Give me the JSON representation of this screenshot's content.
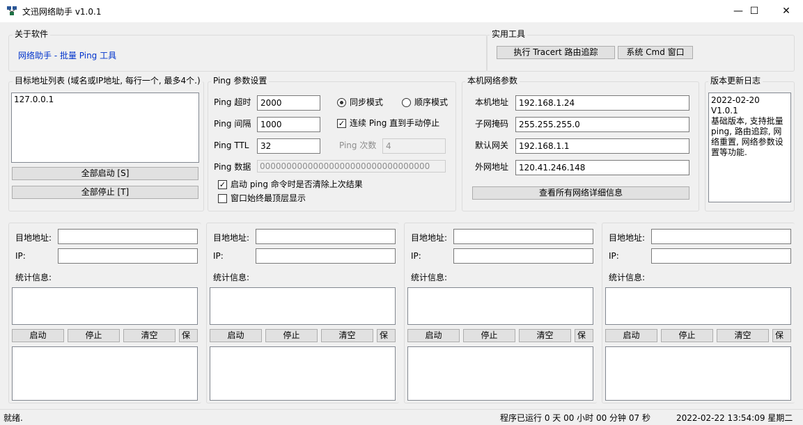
{
  "window": {
    "title": "文迅网络助手  v1.0.1",
    "minimize": "—",
    "maximize": "☐",
    "close": "✕"
  },
  "about": {
    "legend": "关于软件",
    "link": "网络助手 - 批量 Ping 工具"
  },
  "tools": {
    "legend": "实用工具",
    "tracert_button": "执行 Tracert 路由追踪",
    "cmd_button": "系统 Cmd 窗口"
  },
  "targets": {
    "legend": "目标地址列表 (域名或IP地址, 每行一个, 最多4个.)",
    "content": "127.0.0.1",
    "start_all": "全部启动 [S]",
    "stop_all": "全部停止 [T]"
  },
  "ping_settings": {
    "legend": "Ping 参数设置",
    "timeout_label": "Ping 超时",
    "timeout_value": "2000",
    "interval_label": "Ping 间隔",
    "interval_value": "1000",
    "ttl_label": "Ping TTL",
    "ttl_value": "32",
    "data_label": "Ping 数据",
    "data_value": "00000000000000000000000000000000",
    "sync_mode": "同步模式",
    "seq_mode": "顺序模式",
    "continuous": "连续 Ping 直到手动停止",
    "count_label": "Ping 次数",
    "count_value": "4",
    "clear_on_start": "启动 ping 命令时是否清除上次结果",
    "always_on_top": "窗口始终最顶层显示",
    "selected_mode": "sync",
    "continuous_checked": true,
    "clear_on_start_checked": true,
    "always_on_top_checked": false
  },
  "network": {
    "legend": "本机网络参数",
    "local_label": "本机地址",
    "local_value": "192.168.1.24",
    "mask_label": "子网掩码",
    "mask_value": "255.255.255.0",
    "gateway_label": "默认网关",
    "gateway_value": "192.168.1.1",
    "public_label": "外网地址",
    "public_value": "120.41.246.148",
    "details_button": "查看所有网络详细信息"
  },
  "changelog": {
    "legend": "版本更新日志",
    "content": "2022-02-20  V1.0.1\n基础版本, 支持批量ping, 路由追踪, 网络重置, 网络参数设置等功能."
  },
  "panel_labels": {
    "target": "目地地址:",
    "ip": "IP:",
    "stats": "统计信息:",
    "start": "启动",
    "stop": "停止",
    "clear": "清空",
    "save": "保"
  },
  "status": {
    "left": "就绪.",
    "uptime": "程序已运行 0 天 00 小时 00 分钟 07 秒",
    "datetime": "2022-02-22 13:54:09 星期二"
  }
}
